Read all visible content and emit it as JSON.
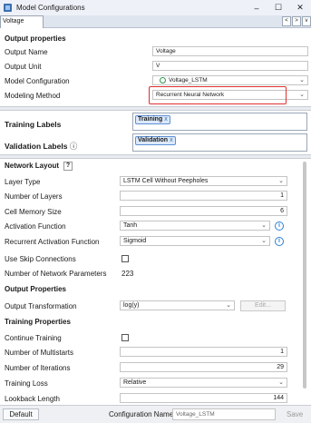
{
  "window": {
    "title": "Model Configurations",
    "minimize": "–",
    "maximize": "☐",
    "close": "✕"
  },
  "tabs": {
    "active": "Voltage",
    "nav": [
      "<",
      ">",
      "v"
    ]
  },
  "output_properties": {
    "heading": "Output properties",
    "output_name_label": "Output Name",
    "output_name_value": "Voltage",
    "output_unit_label": "Output Unit",
    "output_unit_value": "V",
    "model_config_label": "Model Configuration",
    "model_config_value": "Voltage_LSTM",
    "modeling_method_label": "Modeling Method",
    "modeling_method_value": "Recurrent Neural Network"
  },
  "labels": {
    "training_label": "Training Labels",
    "training_tag": "Training",
    "validation_label": "Validation Labels",
    "validation_tag": "Validation",
    "tag_close": "x"
  },
  "network_layout": {
    "heading": "Network Layout",
    "help": "?",
    "layer_type_label": "Layer Type",
    "layer_type_value": "LSTM Cell Without Peepholes",
    "num_layers_label": "Number of Layers",
    "num_layers_value": "1",
    "cell_memory_label": "Cell Memory Size",
    "cell_memory_value": "6",
    "activation_label": "Activation Function",
    "activation_value": "Tanh",
    "recurrent_activation_label": "Recurrent Activation Function",
    "recurrent_activation_value": "Sigmoid",
    "skip_label": "Use Skip Connections",
    "params_label": "Number of Network Parameters",
    "params_value": "223"
  },
  "output_props2": {
    "heading": "Output Properties",
    "transform_label": "Output Transformation",
    "transform_value": "log(y)",
    "edit_label": "Edit..."
  },
  "training": {
    "heading": "Training Properties",
    "continue_label": "Continue Training",
    "multistarts_label": "Number of Multistarts",
    "multistarts_value": "1",
    "iterations_label": "Number of Iterations",
    "iterations_value": "29",
    "loss_label": "Training Loss",
    "loss_value": "Relative",
    "lookback_label": "Lookback Length",
    "lookback_value": "144"
  },
  "bottom": {
    "default_label": "Default",
    "config_name_label": "Configuration Name",
    "config_name_value": "Voltage_LSTM",
    "save_label": "Save"
  },
  "colors": {
    "highlight": "#e0302f",
    "accent": "#2f7fd6"
  },
  "icons": [
    "app-icon",
    "check-circle-icon",
    "info-icon",
    "chevron-down-icon",
    "help-icon"
  ]
}
